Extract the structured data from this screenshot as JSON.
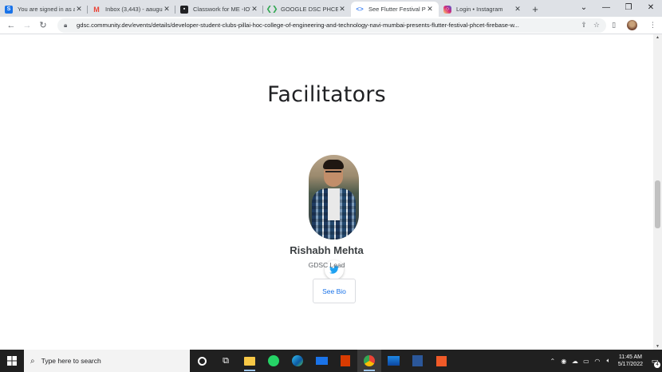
{
  "browser": {
    "tabs": [
      {
        "title": "You are signed in as a",
        "favicon": "s-icon",
        "color": "#1a73e8",
        "active": false
      },
      {
        "title": "Inbox (3,443) - aaugu",
        "favicon": "gmail-icon",
        "color": "#ea4335",
        "active": false
      },
      {
        "title": "Classwork for ME -IOT",
        "favicon": "classroom-icon",
        "color": "#202124",
        "active": false
      },
      {
        "title": "GOOGLE DSC PHCET",
        "favicon": "gdsc-icon",
        "color": "#34a853",
        "active": false
      },
      {
        "title": "See Flutter Festival Pl",
        "favicon": "gdsc-icon",
        "color": "#4285f4",
        "active": true
      },
      {
        "title": "Login • Instagram",
        "favicon": "instagram-icon",
        "color": "#d62976",
        "active": false
      }
    ],
    "url": "gdsc.community.dev/events/details/developer-student-clubs-pillai-hoc-college-of-engineering-and-technology-navi-mumbai-presents-flutter-festival-phcet-firebase-w..."
  },
  "page": {
    "heading": "Facilitators",
    "facilitator": {
      "name": "Rishabh Mehta",
      "role": "GDSC Lead",
      "button_label": "See Bio"
    }
  },
  "taskbar": {
    "search_placeholder": "Type here to search",
    "time": "11:45 AM",
    "date": "5/17/2022",
    "notification_count": "4"
  },
  "colors": {
    "accent": "#1a73e8",
    "twitter": "#1da1f2"
  }
}
